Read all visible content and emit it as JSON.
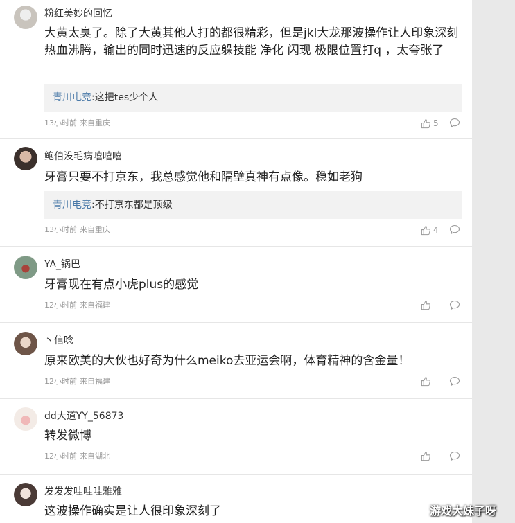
{
  "comments": [
    {
      "user": "粉红美妙的回忆",
      "text": "大黄太臭了。除了大黄其他人打的都很精彩，但是jkl大龙那波操作让人印象深刻热血沸腾，输出的同时迅速的反应躲技能 净化 闪现 极限位置打q ，太夸张了",
      "reply": {
        "name": "青川电竞",
        "sep": ":",
        "text": "这把tes少个人"
      },
      "time": "13小时前",
      "source": "来自重庆",
      "likes": "5",
      "avatar_color": "#c9c4bd"
    },
    {
      "user": "鲍伯没毛病嘻嘻嘻",
      "text": "牙膏只要不打京东，我总感觉他和隔壁真神有点像。稳如老狗",
      "reply": {
        "name": "青川电竞",
        "sep": ":",
        "text": "不打京东都是顶级"
      },
      "time": "13小时前",
      "source": "来自重庆",
      "likes": "4",
      "avatar_color": "#5a4a44"
    },
    {
      "user": "YA_锅巴",
      "text": "牙膏现在有点小虎plus的感觉",
      "time": "12小时前",
      "source": "来自福建",
      "likes": "",
      "avatar_color": "#7f9a86"
    },
    {
      "user": "丶信唸",
      "text": "原来欧美的大伙也好奇为什么meiko去亚运会啊，体育精神的含金量！",
      "time": "12小时前",
      "source": "来自福建",
      "likes": "",
      "avatar_color": "#b89a86"
    },
    {
      "user": "dd大道YY_56873",
      "text": "转发微博",
      "time": "12小时前",
      "source": "来自湖北",
      "likes": "",
      "avatar_color": "#e8dcd6"
    },
    {
      "user": "发发发哇哇哇雅雅",
      "text": "这波操作确实是让人很印象深刻了",
      "avatar_color": "#d7c7c2"
    }
  ],
  "watermark": "游戏大妹子呀",
  "colors": {
    "link": "#4a79a8",
    "reply_bg": "#f2f2f2",
    "meta": "#999999"
  },
  "icons": {
    "like": "thumbs-up-icon",
    "comment": "comment-bubble-icon"
  }
}
